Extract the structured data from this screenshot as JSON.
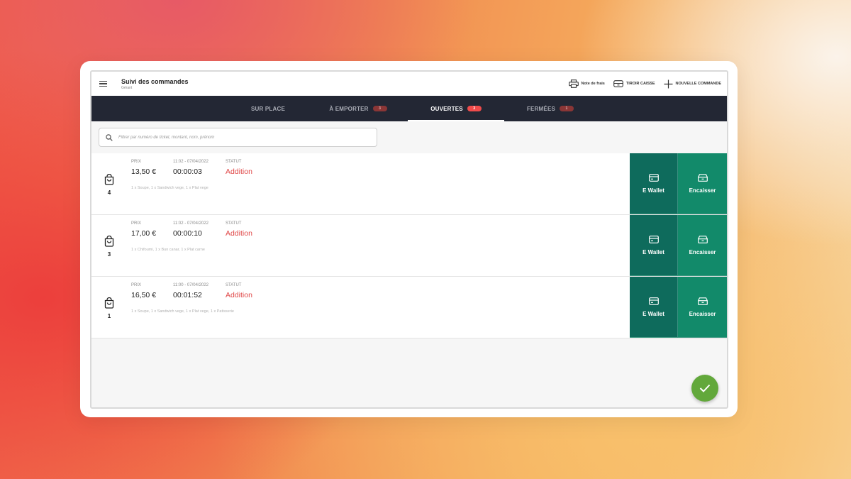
{
  "header": {
    "title": "Suivi des commandes",
    "subtitle": "Gérant",
    "actions": [
      {
        "label": "Note de frais",
        "icon": "printer-icon"
      },
      {
        "label": "TIROIR CAISSE",
        "icon": "cash-drawer-icon"
      },
      {
        "label": "NOUVELLE COMMANDE",
        "icon": "plus-icon"
      }
    ]
  },
  "tabs": [
    {
      "label": "SUR PLACE",
      "badge": ""
    },
    {
      "label": "À EMPORTER",
      "badge": "3"
    },
    {
      "label": "OUVERTES",
      "badge": "3",
      "active": true
    },
    {
      "label": "FERMÉES",
      "badge": "1"
    }
  ],
  "search": {
    "placeholder": "Filtrer par numéro de ticket, montant, nom, prénom"
  },
  "order_labels": {
    "price": "PRIX",
    "status": "STATUT"
  },
  "orders": [
    {
      "number": "4",
      "price": "13,50 €",
      "datetime": "11:02 - 07/04/2022",
      "elapsed": "00:00:03",
      "status": "Addition",
      "items": "1 x Soupe, 1 x Sandwich vege, 1 x Plat vege"
    },
    {
      "number": "3",
      "price": "17,00 €",
      "datetime": "11:02 - 07/04/2022",
      "elapsed": "00:00:10",
      "status": "Addition",
      "items": "1 x Chifoumi, 1 x Bun canar, 1 x Plat carne"
    },
    {
      "number": "1",
      "price": "16,50 €",
      "datetime": "11:00 - 07/04/2022",
      "elapsed": "00:01:52",
      "status": "Addition",
      "items": "1 x Soupe, 1 x Sandwich vege, 1 x Plat vege, 1 x Patisserie"
    }
  ],
  "buttons": {
    "wallet": "E Wallet",
    "cash": "Encaisser"
  },
  "colors": {
    "tab_bar": "#232734",
    "wallet_button": "#0e6b5c",
    "cash_button": "#128a6a",
    "status_text": "#e04848",
    "fab": "#62a83b"
  }
}
